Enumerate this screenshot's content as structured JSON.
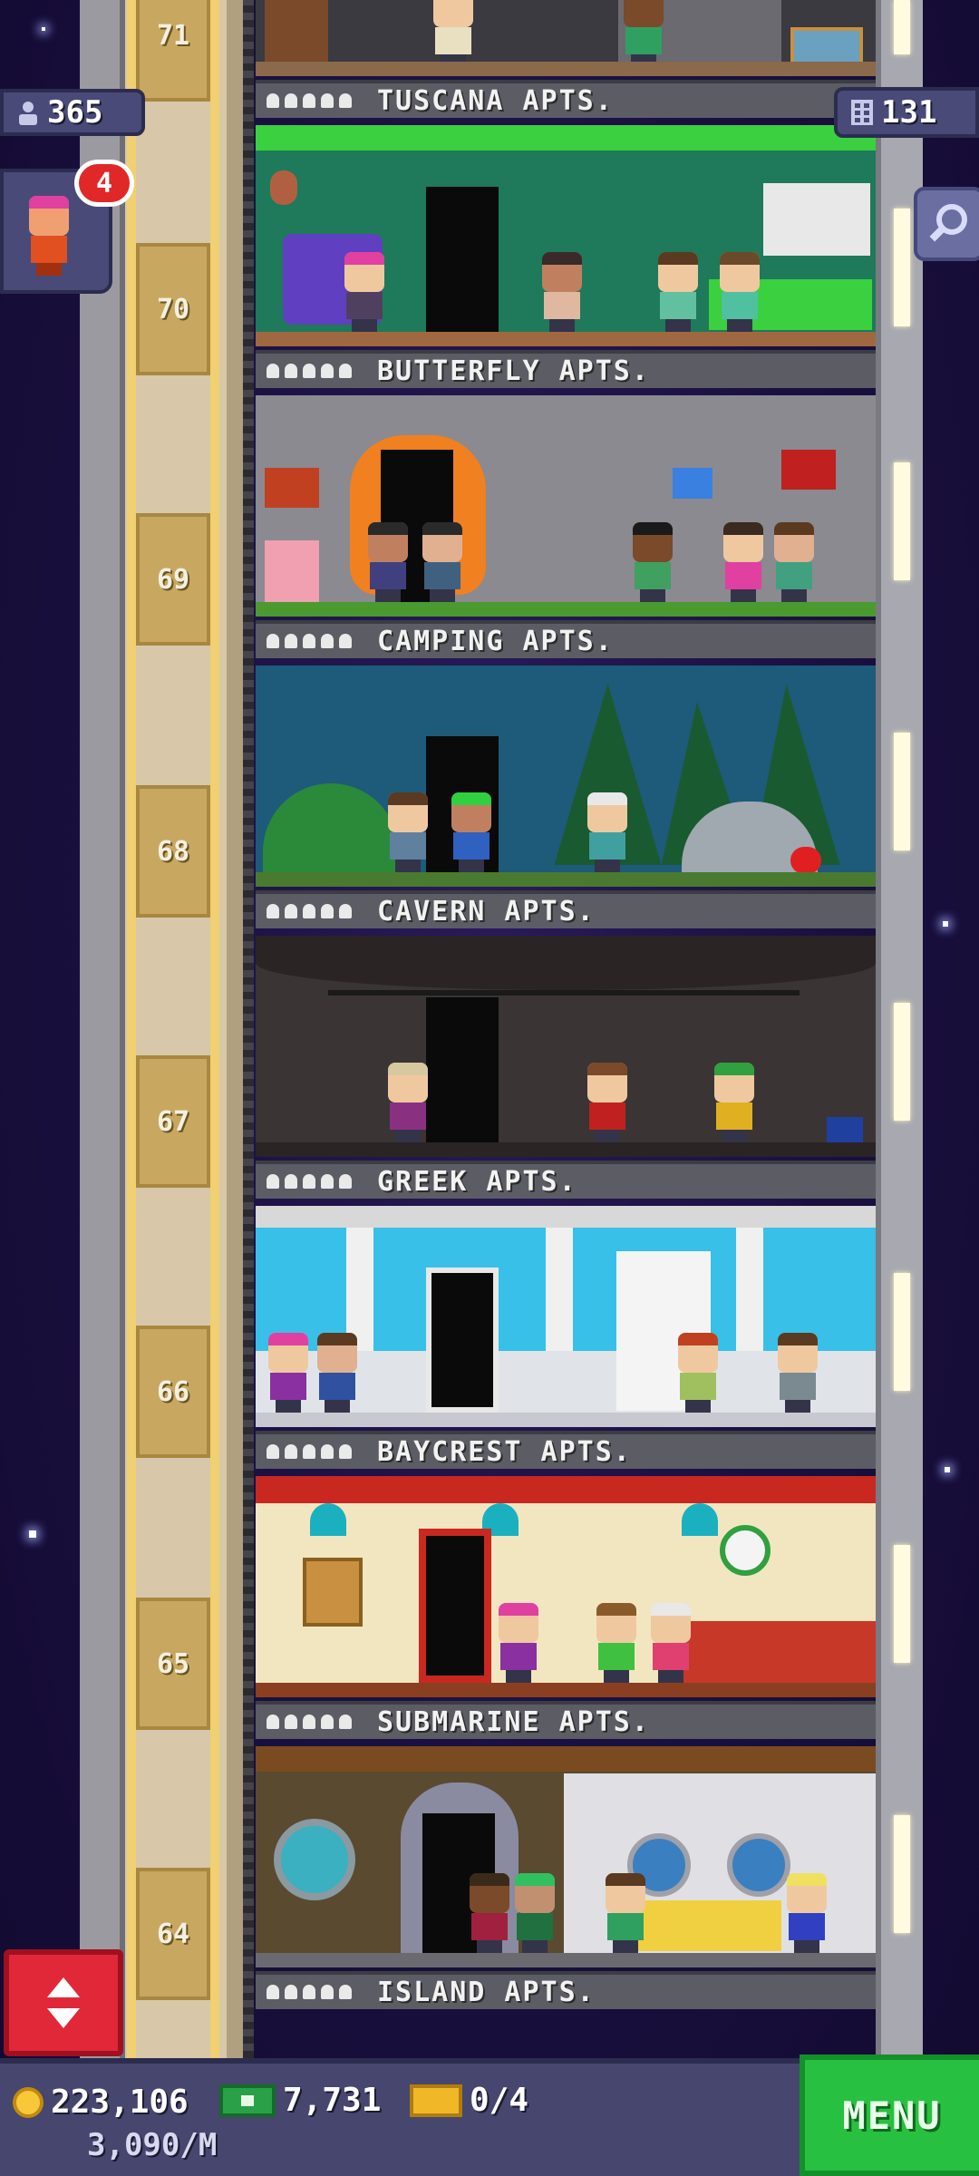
{
  "hud": {
    "population": "365",
    "floors_count": "131",
    "notification_count": "4"
  },
  "elevator": {
    "floor_numbers": [
      "71",
      "70",
      "69",
      "68",
      "67",
      "66",
      "65",
      "64"
    ]
  },
  "floors": [
    {
      "name": "TUSCANA APTS.",
      "theme_color": "#3a3a40"
    },
    {
      "name": "BUTTERFLY APTS.",
      "theme_color": "#1e7a5a"
    },
    {
      "name": "CAMPING APTS.",
      "theme_color": "#8a8a90"
    },
    {
      "name": "CAVERN APTS.",
      "theme_color": "#1e5a7a"
    },
    {
      "name": "GREEK APTS.",
      "theme_color": "#3a3434"
    },
    {
      "name": "BAYCREST APTS.",
      "theme_color": "#38c0e8"
    },
    {
      "name": "SUBMARINE APTS.",
      "theme_color": "#f2e6c0"
    },
    {
      "name": "ISLAND APTS.",
      "theme_color": "#5a4a30"
    }
  ],
  "bottom_bar": {
    "coins": "223,106",
    "bux": "7,731",
    "tickets": "0/4",
    "rate": "3,090/M",
    "menu_label": "MENU"
  },
  "colors": {
    "accent_green": "#28c040",
    "accent_red": "#e02838",
    "hud_purple": "#4a4a78"
  },
  "icons": [
    "people-icon",
    "floors-icon",
    "search-icon",
    "elevator-arrows-icon",
    "coin-icon",
    "bux-icon",
    "ticket-icon"
  ]
}
